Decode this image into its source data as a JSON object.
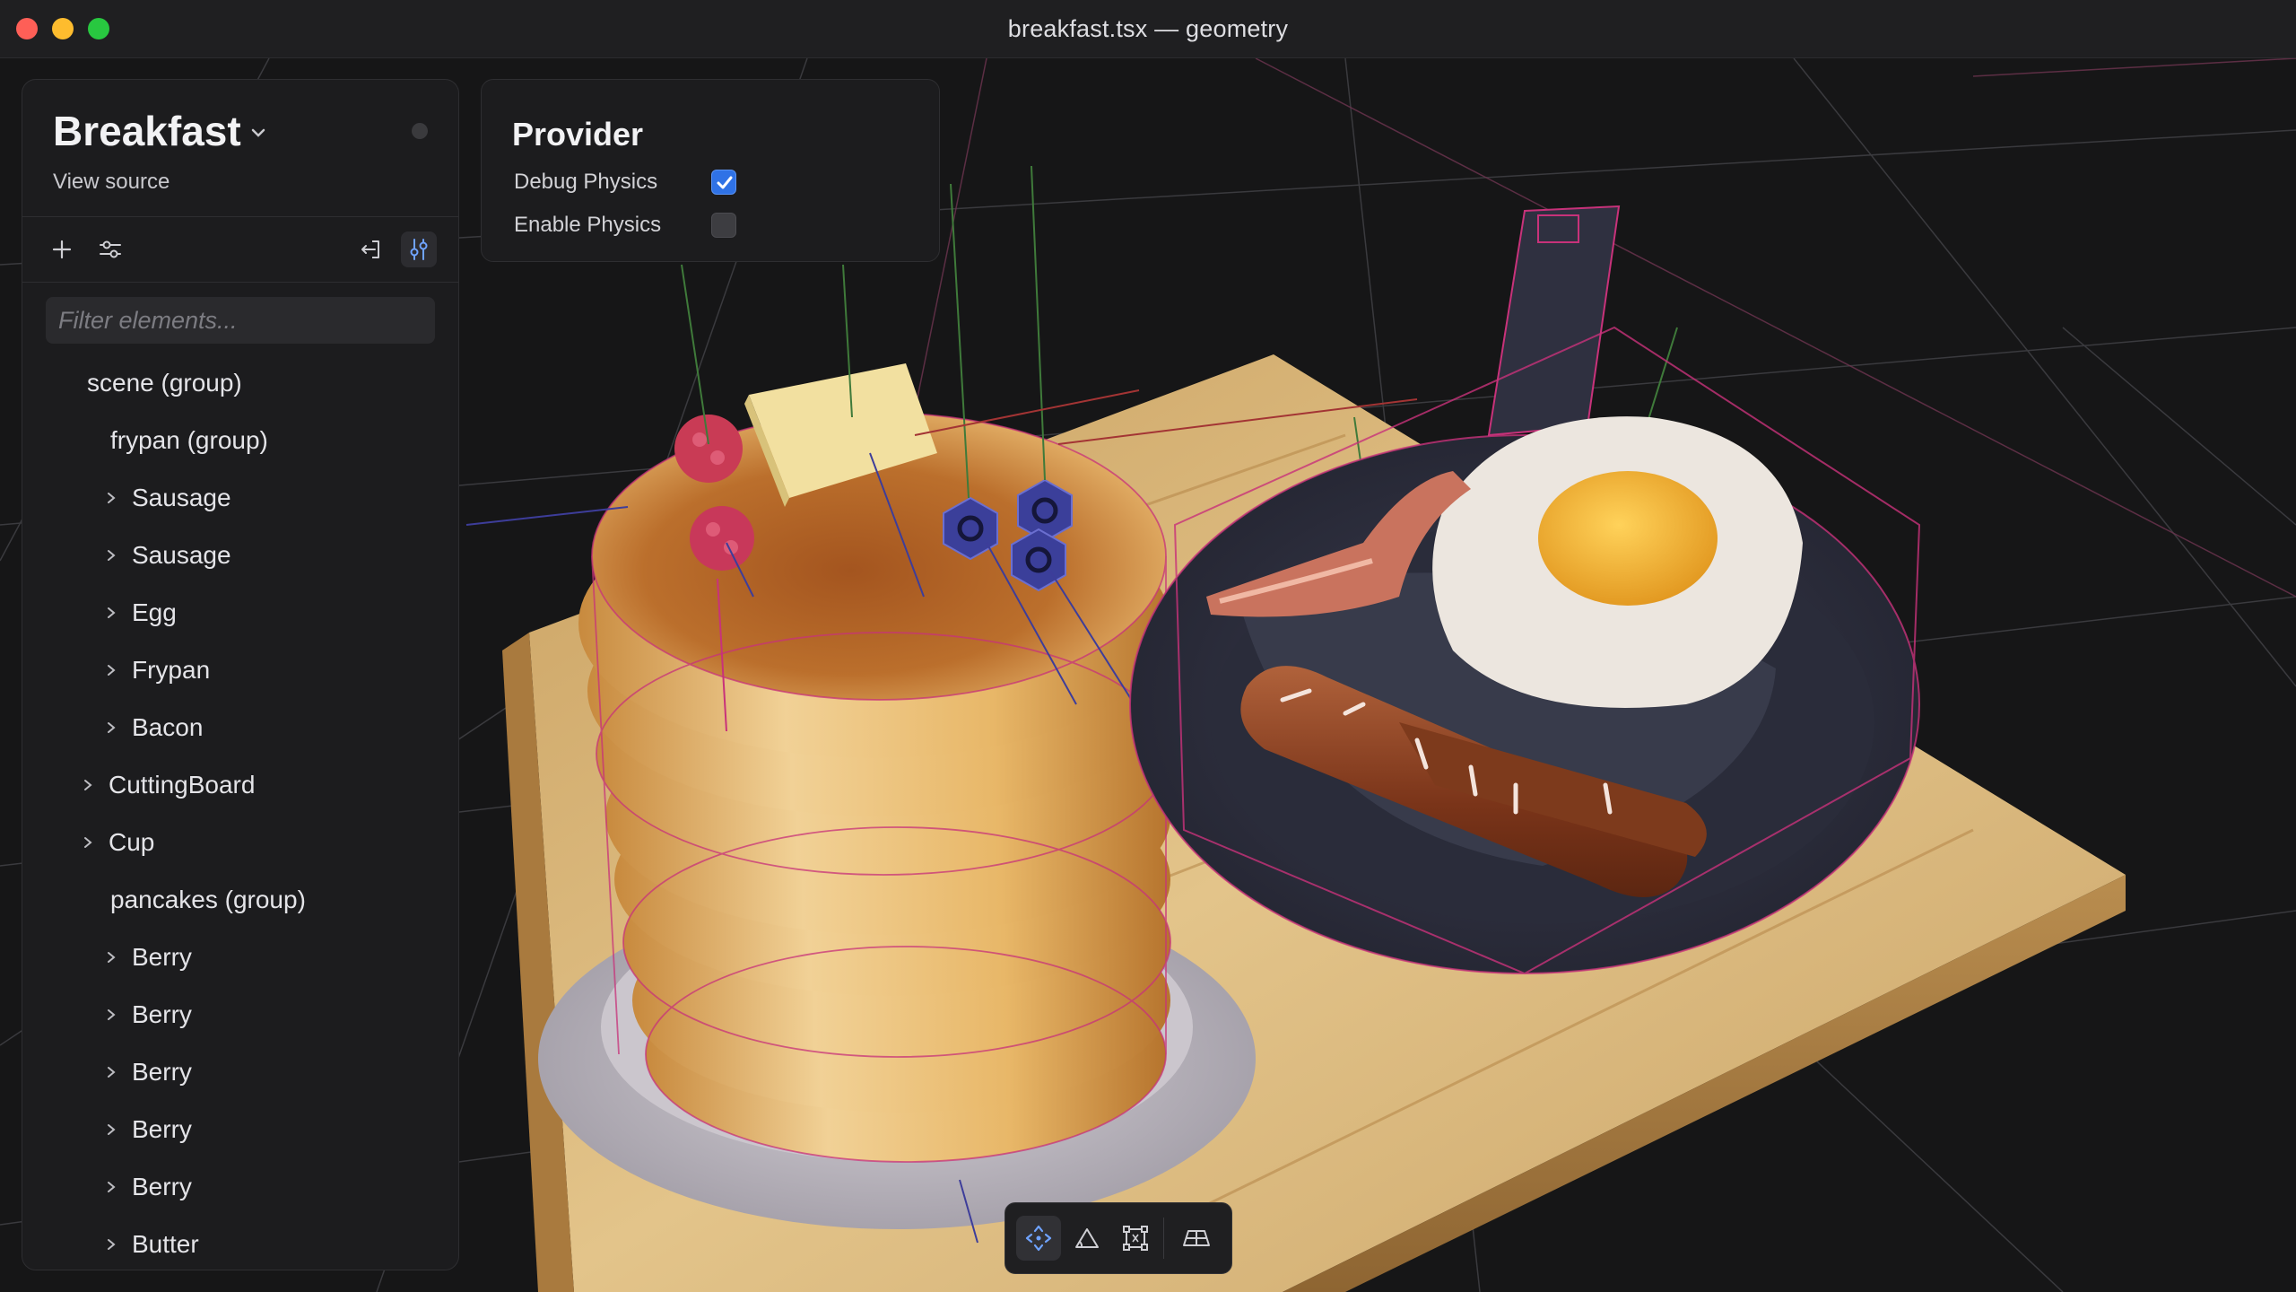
{
  "window": {
    "title": "breakfast.tsx — geometry"
  },
  "sidebar": {
    "project_title": "Breakfast",
    "view_source": "View source",
    "filter_placeholder": "Filter elements...",
    "tree": [
      {
        "label": "scene (group)",
        "expandable": false
      },
      {
        "label": "frypan (group)",
        "expandable": false
      },
      {
        "label": "Sausage",
        "expandable": true
      },
      {
        "label": "Sausage",
        "expandable": true
      },
      {
        "label": "Egg",
        "expandable": true
      },
      {
        "label": "Frypan",
        "expandable": true
      },
      {
        "label": "Bacon",
        "expandable": true
      },
      {
        "label": "CuttingBoard",
        "expandable": true
      },
      {
        "label": "Cup",
        "expandable": true
      },
      {
        "label": "pancakes (group)",
        "expandable": false
      },
      {
        "label": "Berry",
        "expandable": true
      },
      {
        "label": "Berry",
        "expandable": true
      },
      {
        "label": "Berry",
        "expandable": true
      },
      {
        "label": "Berry",
        "expandable": true
      },
      {
        "label": "Berry",
        "expandable": true
      },
      {
        "label": "Butter",
        "expandable": true
      }
    ]
  },
  "provider": {
    "title": "Provider",
    "debug_physics_label": "Debug Physics",
    "debug_physics_checked": true,
    "enable_physics_label": "Enable Physics",
    "enable_physics_checked": false
  },
  "gizmo_toolbar": {
    "tools": [
      "move-icon",
      "triangle-icon",
      "bounding-box-icon",
      "grid-view-icon"
    ],
    "active_tool": "move-icon"
  },
  "colors": {
    "accent": "#2f72e6",
    "viewport_bg": "#161617",
    "wireframe": "#c8327a"
  }
}
